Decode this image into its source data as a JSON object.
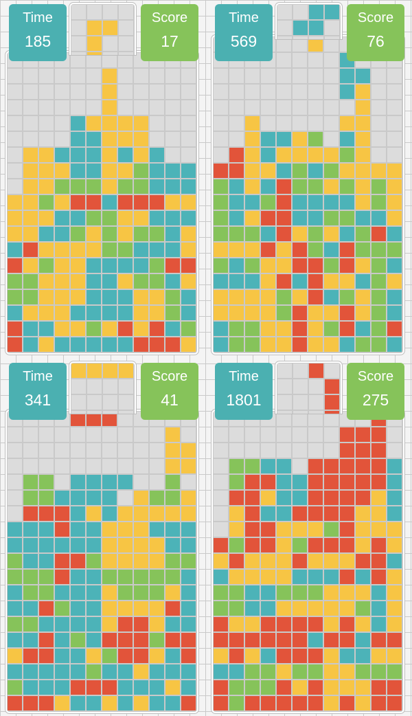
{
  "colors": {
    "R": "#e2543a",
    "Y": "#f7c544",
    "G": "#86c35a",
    "C": "#4cb3b8",
    "empty": "#dcdcdc",
    "time_badge": "#4bb0b1",
    "score_badge": "#86c35a"
  },
  "games": [
    {
      "time_label": "Time",
      "time_value": "185",
      "score_label": "Score",
      "score_value": "17",
      "preview": [
        "....",
        ".YY.",
        ".Y..",
        ".Y.."
      ],
      "board": [
        "............",
        "......Y.....",
        "......Y.....",
        "......Y.....",
        "....CYYYY...",
        "....CCYYY...",
        ".YYCCCYCYC..",
        ".YYYCCYYGCCC",
        ".YYGGGYGGCCC",
        "YYGYRRCRRRYY",
        "YYYCCGGYYCCC",
        "YYCCGYGYGGCY",
        "CRYYYYGGCCCY",
        "RYGYYCCCCGRR",
        "GGYYYCCYGGCY",
        "GGYYYCCCYYGC",
        "CYYYCCCCYYGC",
        "RCCYYGYRYRCG",
        "RCYCCCCCRRRY"
      ]
    },
    {
      "time_label": "Time",
      "time_value": "569",
      "score_label": "Score",
      "score_value": "76",
      "preview": [
        "..CC",
        ".CC.",
        "....",
        "...."
      ],
      "board": [
        "......Y.....",
        "........C...",
        "........CC..",
        "........CY..",
        ".........Y..",
        "..Y.....YY..",
        "..YCCYG.CY..",
        ".RYCYYYYGY..",
        "RRYYCGCGYYYY",
        "GCYCRGGYGYGY",
        "GCCGRCCCCYGY",
        "GCYRRCCGGCCY",
        "GGGCRYGYCGRC",
        "YYYRYRGCRGGG",
        "GCGYYRRGRYGC",
        "CCCYRCRYYCGY",
        "YYYYGYRCGYGC",
        "YYYYGRYYRYGC",
        "CGGYYRYGRCGR",
        "CGGYYRYYCGGC"
      ]
    },
    {
      "time_label": "Time",
      "time_value": "341",
      "score_label": "Score",
      "score_value": "41",
      "preview": [
        "YYYY",
        "....",
        "....",
        "...."
      ],
      "board": [
        "....RRR.....",
        "..........Y.",
        "..........YY",
        "..........YY",
        ".GG.CCCC..G.",
        ".GGCCCC.YGGY",
        ".RRRCYCYYYYY",
        "CCCRCCYYYCCC",
        "CCCCCCYYYYCC",
        "GCCRRGYYYYGG",
        "GGGRCCGGGGGC",
        "CGGCCCYGGGYC",
        "CCRGCCYYYYRC",
        "GGCCCCYRRYCC",
        "CCRCGCRRRGRR",
        "YRRCCYGRRYCR",
        "CCCCCGCCYCCC",
        "GCCCRRRCCCYC",
        "RRRYCCYCYCCR"
      ]
    },
    {
      "time_label": "Time",
      "time_value": "1801",
      "score_label": "Score",
      "score_value": "275",
      "preview": [
        "..R.",
        "...R",
        "...R",
        "...R"
      ],
      "board": [
        "..........R.",
        "........RRR.",
        "........RRR.",
        ".GGCC.RRRRRC",
        ".GRRCCRRRRRC",
        ".RRYCCRRRRYC",
        ".YRCCRRRRYYC",
        ".YRRYYYGRYYY",
        "RGRRYGRRRYRY",
        "YRYYYRYYYRRC",
        "CYYYYCCCRCRY",
        "GGCCGGGYYYCY",
        "GGCCYYYYYGCY",
        "RYYRRRRYRYCY",
        "RRRRRRCRRCRR",
        "YRYCRRRYCCYY",
        "CCGGYGGYYGGG",
        "RGGGRYRYYYRR",
        "RGRRRRRYRYRR"
      ]
    }
  ]
}
